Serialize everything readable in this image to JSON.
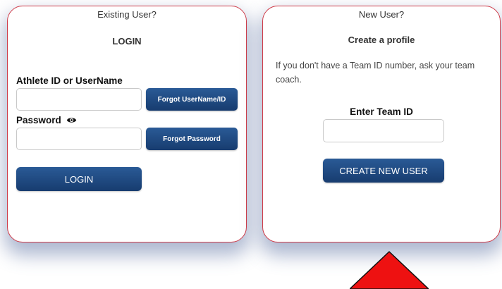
{
  "existing_user": {
    "title": "Existing User?",
    "subtitle": "LOGIN",
    "athlete_label": "Athlete ID or UserName",
    "athlete_value": "",
    "forgot_username_label": "Forgot UserName/ID",
    "password_label": "Password",
    "password_value": "",
    "forgot_password_label": "Forgot Password",
    "login_button_label": "LOGIN"
  },
  "new_user": {
    "title": "New User?",
    "subtitle": "Create a profile",
    "info_text": "If you don't have a Team ID number, ask your team coach.",
    "team_id_label": "Enter Team ID",
    "team_id_value": "",
    "create_button_label": "CREATE NEW USER"
  },
  "icons": {
    "password_toggle": "eye-icon",
    "pointer": "red-triangle-arrow"
  },
  "colors": {
    "panel_border": "#cf3b48",
    "button_bg": "#1f4a82",
    "arrow": "#ee1111"
  }
}
